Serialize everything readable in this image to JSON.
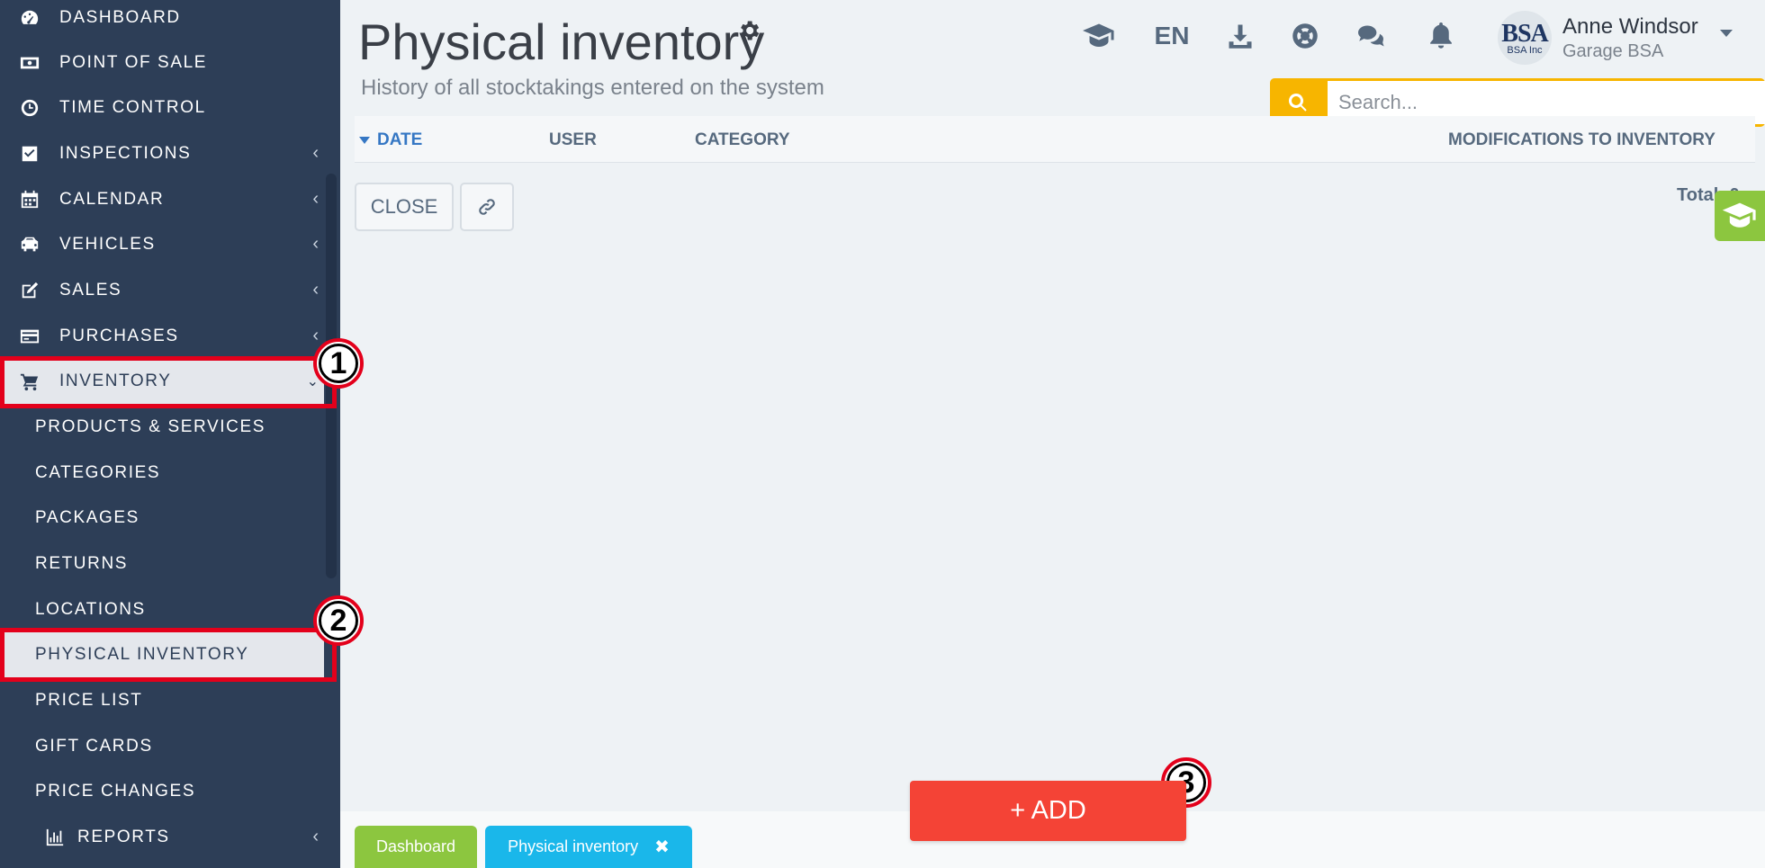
{
  "sidebar": {
    "items": [
      {
        "label": "DASHBOARD",
        "icon": "dashboard-gauge-icon",
        "has_chevron": false
      },
      {
        "label": "POINT OF SALE",
        "icon": "money-bill-icon",
        "has_chevron": false
      },
      {
        "label": "TIME CONTROL",
        "icon": "clock-icon",
        "has_chevron": false
      },
      {
        "label": "INSPECTIONS",
        "icon": "checkbox-icon",
        "has_chevron": true
      },
      {
        "label": "CALENDAR",
        "icon": "calendar-icon",
        "has_chevron": true
      },
      {
        "label": "VEHICLES",
        "icon": "car-icon",
        "has_chevron": true
      },
      {
        "label": "SALES",
        "icon": "edit-icon",
        "has_chevron": true
      },
      {
        "label": "PURCHASES",
        "icon": "credit-card-icon",
        "has_chevron": true
      },
      {
        "label": "INVENTORY",
        "icon": "cart-icon",
        "has_chevron": true,
        "expanded": true
      }
    ],
    "inventory_subitems": [
      {
        "label": "PRODUCTS & SERVICES"
      },
      {
        "label": "CATEGORIES"
      },
      {
        "label": "PACKAGES"
      },
      {
        "label": "RETURNS"
      },
      {
        "label": "LOCATIONS"
      },
      {
        "label": "PHYSICAL INVENTORY",
        "active": true
      },
      {
        "label": "PRICE LIST"
      },
      {
        "label": "GIFT CARDS"
      },
      {
        "label": "PRICE CHANGES"
      }
    ],
    "reports": {
      "label": "REPORTS",
      "icon": "bar-chart-icon"
    }
  },
  "callouts": [
    "1",
    "2",
    "3"
  ],
  "header": {
    "title": "Physical inventory",
    "subtitle": "History of all stocktakings entered on the system",
    "language": "EN",
    "user_name": "Anne Windsor",
    "user_org": "Garage BSA",
    "avatar_text": "BSA",
    "avatar_subtext": "BSA Inc"
  },
  "search": {
    "placeholder": "Search..."
  },
  "table": {
    "columns": [
      "DATE",
      "USER",
      "CATEGORY",
      "MODIFICATIONS TO INVENTORY"
    ],
    "sorted_column": "DATE"
  },
  "actions": {
    "close_label": "CLOSE",
    "total_label": "Total: 0"
  },
  "add_button": {
    "label": "+ ADD"
  },
  "bottom_tabs": [
    {
      "label": "Dashboard",
      "color": "#8cc63f"
    },
    {
      "label": "Physical inventory",
      "color": "#1ab7ea",
      "closable": true
    }
  ],
  "colors": {
    "sidebar_bg": "#2d3e57",
    "highlight": "#e3001b",
    "accent_search": "#f7b500",
    "add_button": "#f44336",
    "sort_blue": "#3577c4"
  }
}
